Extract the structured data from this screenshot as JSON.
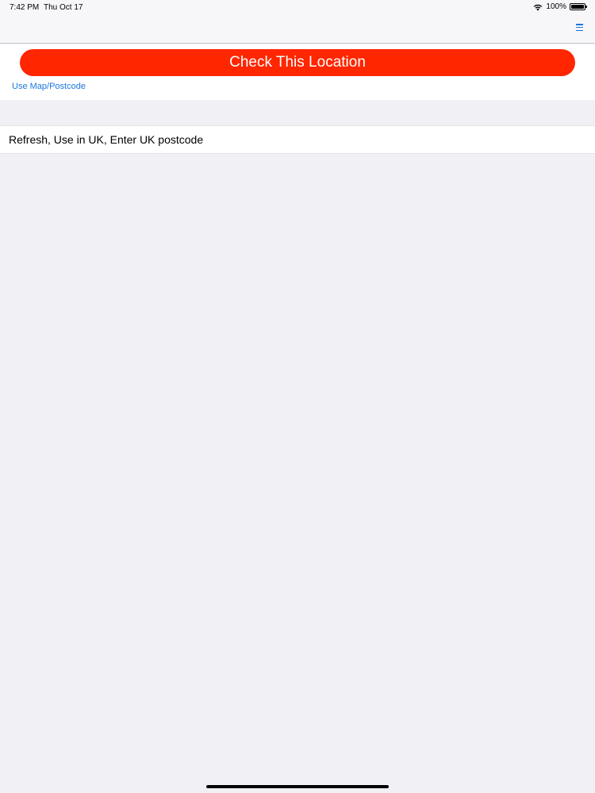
{
  "status_bar": {
    "time": "7:42 PM",
    "date": "Thu Oct 17",
    "battery": "100%",
    "battery_level": 1.0,
    "wifi_icon": "wifi-icon",
    "battery_icon": "battery-icon"
  },
  "nav_bar": {
    "menu_icon": "hamburger-menu-icon",
    "accent_color": "#1b76e0"
  },
  "main": {
    "check_button_label": "Check This Location",
    "check_button_color": "#ff2600",
    "use_map_link": "Use Map/Postcode",
    "list_items": [
      {
        "label": "Refresh, Use in UK, Enter UK postcode"
      }
    ]
  }
}
